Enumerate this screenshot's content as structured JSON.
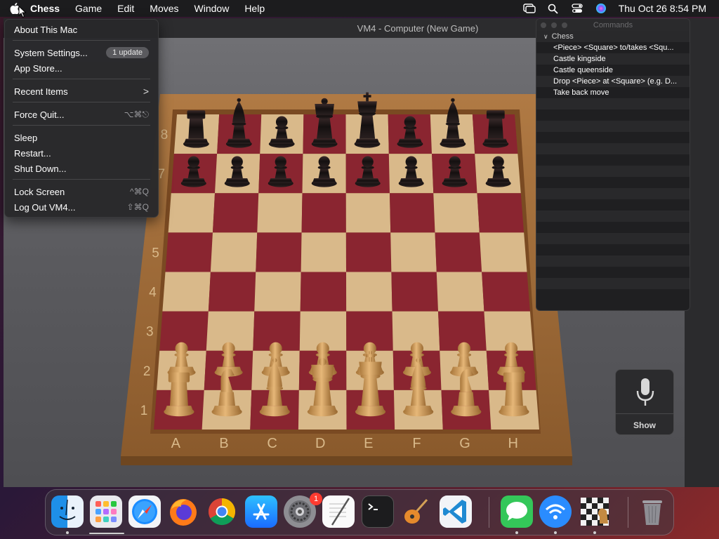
{
  "menubar": {
    "app_name": "Chess",
    "menus": [
      "Game",
      "Edit",
      "Moves",
      "Window",
      "Help"
    ],
    "datetime": "Thu Oct 26  8:54 PM",
    "icons": [
      "apple-icon",
      "screen-mirroring-icon",
      "spotlight-search-icon",
      "control-center-icon",
      "siri-icon"
    ]
  },
  "chess_window": {
    "title": "VM4 - Computer   (New Game)",
    "rank_labels": [
      "8",
      "7",
      "5",
      "4",
      "3",
      "2",
      "1"
    ],
    "file_labels": [
      "A",
      "B",
      "C",
      "D",
      "E",
      "F",
      "G",
      "H"
    ],
    "black_back_rank": [
      "rook",
      "bishop",
      "pawn",
      "queen",
      "king",
      "pawn",
      "bishop",
      "rook"
    ],
    "white_back_rank": [
      "rook",
      "knight",
      "bishop",
      "queen",
      "king",
      "bishop",
      "knight",
      "rook"
    ]
  },
  "apple_menu": {
    "items": [
      {
        "label": "About This Mac",
        "shortcut": ""
      },
      {
        "label": "System Settings...",
        "badge": "1 update"
      },
      {
        "label": "App Store...",
        "shortcut": ""
      },
      {
        "label": "Recent Items",
        "shortcut": ">"
      },
      {
        "label": "Force Quit...",
        "shortcut": "⌥⌘⎋"
      },
      {
        "label": "Sleep",
        "shortcut": ""
      },
      {
        "label": "Restart...",
        "shortcut": ""
      },
      {
        "label": "Shut Down...",
        "shortcut": ""
      },
      {
        "label": "Lock Screen",
        "shortcut": "^⌘Q"
      },
      {
        "label": "Log Out VM4...",
        "shortcut": "⇧⌘Q"
      }
    ]
  },
  "commands_panel": {
    "title": "Commands",
    "group": "Chess",
    "items": [
      "<Piece> <Square> to/takes <Squ...",
      "Castle kingside",
      "Castle queenside",
      "Drop <Piece> at <Square> (e.g. D...",
      "Take back move"
    ]
  },
  "voice": {
    "show_label": "Show"
  },
  "dock": {
    "apps": [
      "finder",
      "launchpad",
      "safari",
      "firefox",
      "chrome",
      "app-store",
      "system-settings",
      "textedit",
      "terminal",
      "garageband",
      "vscode",
      "messages",
      "network-utility",
      "chess",
      "trash"
    ],
    "system_settings_badge": "1"
  },
  "colors": {
    "menubar": "#1c1c1e",
    "board_dark": "#8a2530",
    "board_light": "#d9b98a",
    "frame": "#a8723e"
  }
}
